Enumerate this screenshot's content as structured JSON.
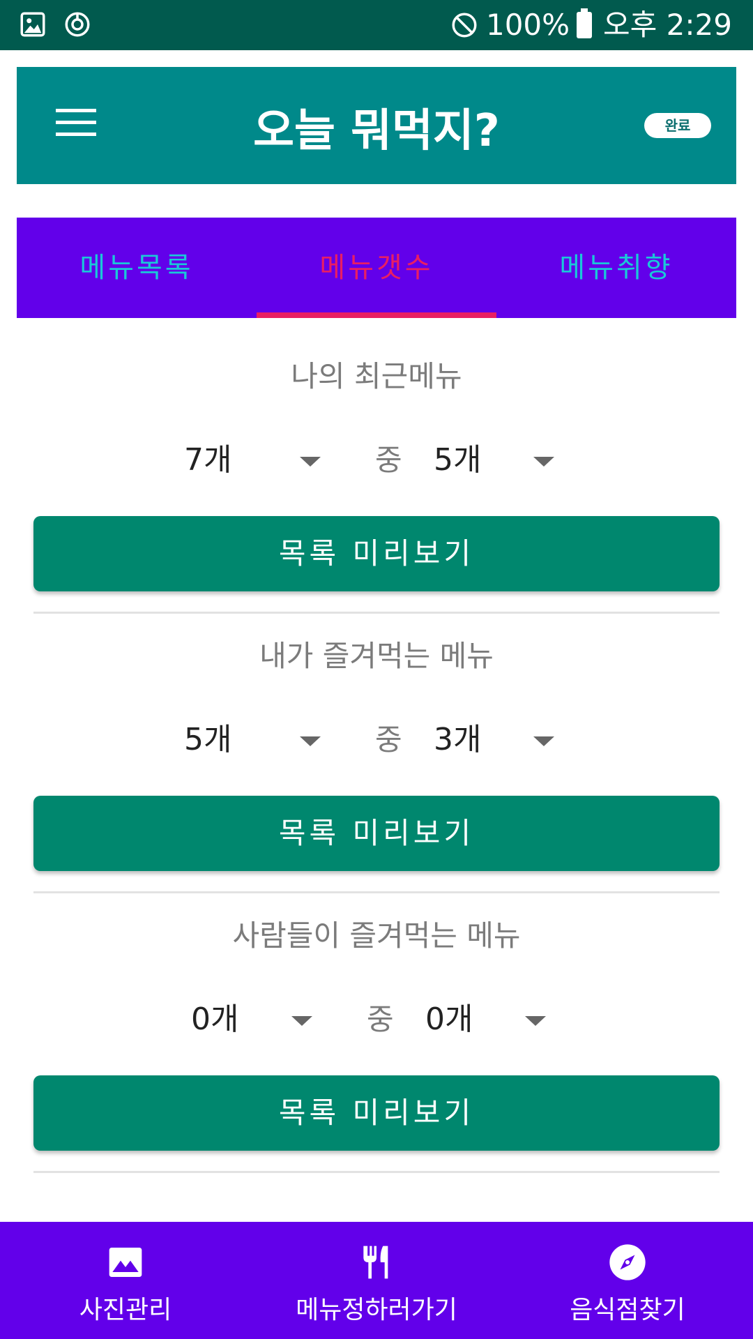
{
  "status_bar": {
    "battery": "100%",
    "time": "오후 2:29",
    "icons": [
      "image-icon",
      "sync-icon",
      "do-not-disturb-icon",
      "battery-icon"
    ]
  },
  "app_bar": {
    "title": "오늘 뭐먹지?",
    "done_label": "완료",
    "menu_icon": "hamburger-menu-icon"
  },
  "tabs": [
    {
      "label": "메뉴목록",
      "active": false
    },
    {
      "label": "메뉴갯수",
      "active": true
    },
    {
      "label": "메뉴취향",
      "active": false
    }
  ],
  "sections": [
    {
      "title": "나의 최근메뉴",
      "total": "7개",
      "between": "중",
      "pick": "5개",
      "button": "목록 미리보기"
    },
    {
      "title": "내가 즐겨먹는 메뉴",
      "total": "5개",
      "between": "중",
      "pick": "3개",
      "button": "목록 미리보기"
    },
    {
      "title": "사람들이 즐겨먹는 메뉴",
      "total": "0개",
      "between": "중",
      "pick": "0개",
      "button": "목록 미리보기"
    }
  ],
  "bottom_nav": [
    {
      "label": "사진관리",
      "icon": "photo-icon"
    },
    {
      "label": "메뉴정하러가기",
      "icon": "fork-knife-icon"
    },
    {
      "label": "음식점찾기",
      "icon": "compass-icon"
    }
  ],
  "colors": {
    "status_bar": "#015A4E",
    "app_bar": "#00898A",
    "tab_bar": "#6200EA",
    "tab_text": "#1AC8D8",
    "tab_active": "#E91E63",
    "button": "#00876E",
    "bottom_nav": "#6200EA"
  }
}
